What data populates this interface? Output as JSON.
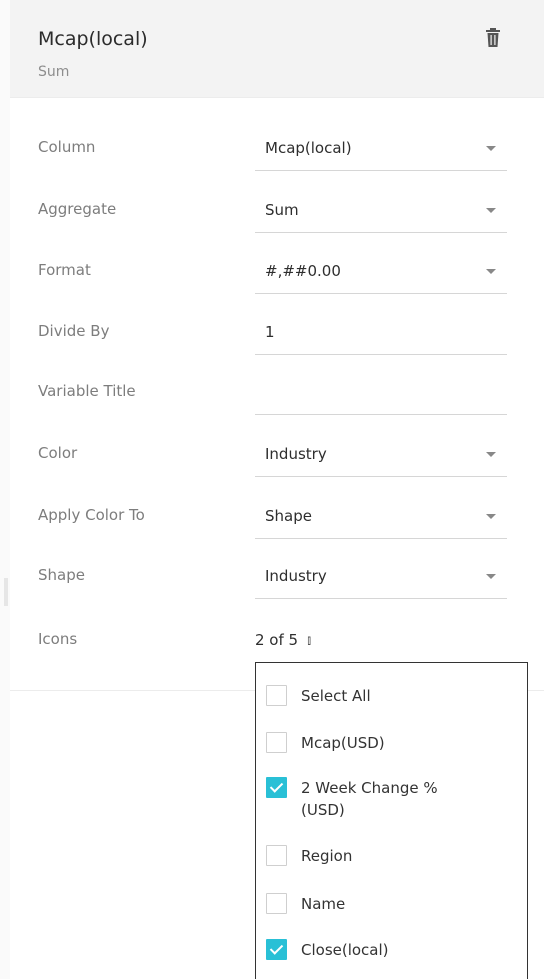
{
  "header": {
    "title": "Mcap(local)",
    "subtitle": "Sum",
    "delete_icon": "trash-icon"
  },
  "form": {
    "column": {
      "label": "Column",
      "value": "Mcap(local)"
    },
    "aggregate": {
      "label": "Aggregate",
      "value": "Sum"
    },
    "format": {
      "label": "Format",
      "value": "#,##0.00"
    },
    "divide_by": {
      "label": "Divide By",
      "value": "1"
    },
    "variable_title": {
      "label": "Variable Title",
      "value": ""
    },
    "color": {
      "label": "Color",
      "value": "Industry"
    },
    "apply_color_to": {
      "label": "Apply Color To",
      "value": "Shape"
    },
    "shape": {
      "label": "Shape",
      "value": "Industry"
    },
    "icons": {
      "label": "Icons",
      "value": "2 of 5",
      "expand_icon": "double-chevron-down-icon"
    }
  },
  "icons_dropdown": {
    "options": [
      {
        "label": "Select All",
        "checked": false
      },
      {
        "label": "Mcap(USD)",
        "checked": false
      },
      {
        "label": "2 Week Change % (USD)",
        "checked": true
      },
      {
        "label": "Region",
        "checked": false
      },
      {
        "label": "Name",
        "checked": false
      },
      {
        "label": "Close(local)",
        "checked": true
      }
    ]
  },
  "colors": {
    "header_bg": "#f3f3f3",
    "checkbox_checked": "#29c0d6"
  }
}
